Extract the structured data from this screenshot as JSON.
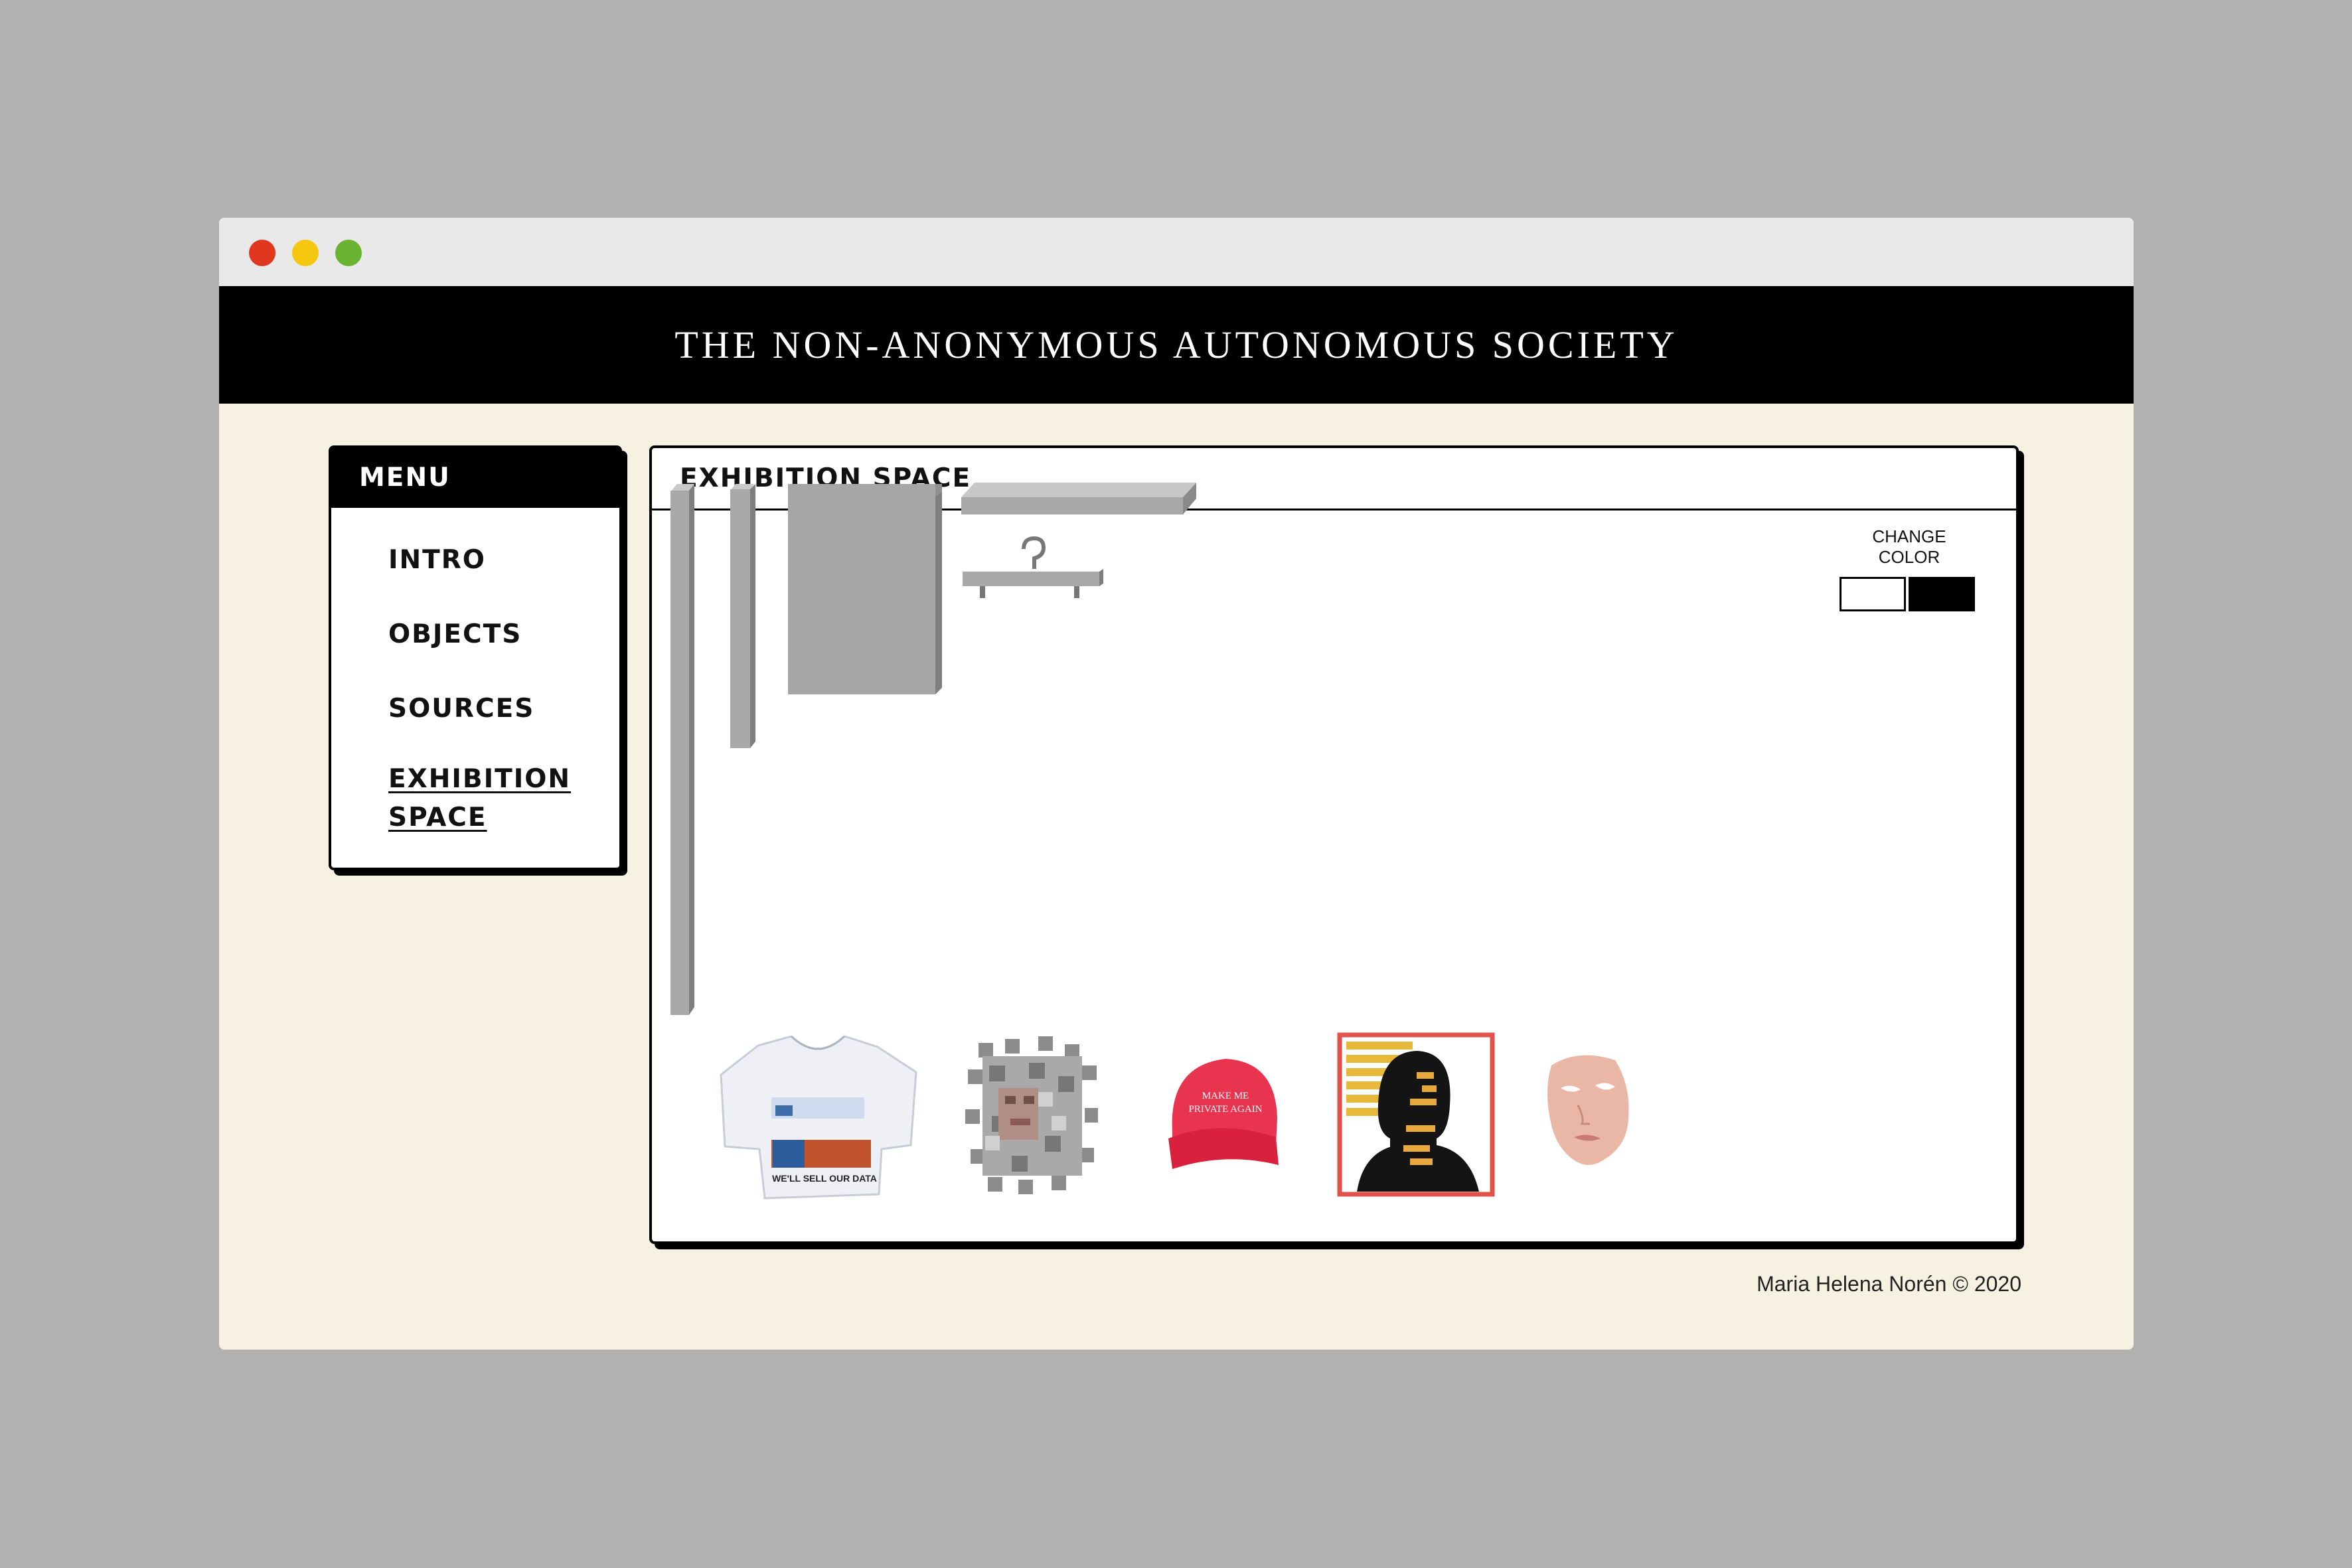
{
  "window": {
    "controls": [
      "close",
      "minimize",
      "maximize"
    ]
  },
  "site": {
    "title": "THE NON-ANONYMOUS AUTONOMOUS SOCIETY"
  },
  "menu": {
    "title": "MENU",
    "items": [
      {
        "label": "INTRO"
      },
      {
        "label": "OBJECTS"
      },
      {
        "label": "SOURCES"
      },
      {
        "label": "EXHIBITION SPACE",
        "active": true
      }
    ]
  },
  "exhibition": {
    "title": "EXHIBITION SPACE",
    "change_color": {
      "label": "CHANGE COLOR",
      "options": [
        {
          "name": "white",
          "color": "#ffffff"
        },
        {
          "name": "black",
          "color": "#000000"
        }
      ]
    },
    "furniture": [
      "tall-wall-panel",
      "narrow-wall-panel",
      "display-board",
      "shelf",
      "clothes-hanger"
    ],
    "objects": [
      "t-shirt",
      "pixelated-portrait",
      "red-cap",
      "face-recognition-print",
      "face-mask"
    ],
    "cap_text": [
      "MAKE ME",
      "PRIVATE AGAIN"
    ],
    "tshirt_text": "WE'LL SELL OUR DATA"
  },
  "footer": {
    "credit": "Maria Helena Norén © 2020"
  }
}
